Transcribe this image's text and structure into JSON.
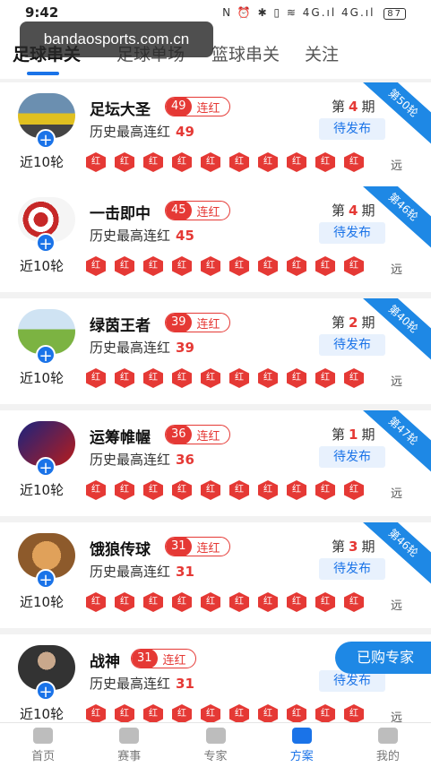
{
  "status": {
    "time": "9:42",
    "icons": "N ⏰ ✱ ▯ ≋ 4G.ıl 4G.ıl",
    "battery": "87"
  },
  "watermark": "bandaosports.com.cn",
  "tabs": [
    "足球串关",
    "足球单场",
    "篮球串关",
    "关注"
  ],
  "labels": {
    "hist": "历史最高连红",
    "streak": "连红",
    "recent": "近10轮",
    "far": "远",
    "round_prefix": "第",
    "round_suffix": "期",
    "pending": "待发布",
    "mark": "红"
  },
  "experts": [
    {
      "name": "足坛大圣",
      "streak": "49",
      "best": "49",
      "round": "4",
      "ribbon": "第50轮",
      "avatar": "yellow-car"
    },
    {
      "name": "一击即中",
      "streak": "45",
      "best": "45",
      "round": "4",
      "ribbon": "第46轮",
      "avatar": "target-dart"
    },
    {
      "name": "绿茵王者",
      "streak": "39",
      "best": "39",
      "round": "2",
      "ribbon": "第40轮",
      "avatar": "green-field"
    },
    {
      "name": "运筹帷幄",
      "streak": "36",
      "best": "36",
      "round": "1",
      "ribbon": "第47轮",
      "avatar": "football-player"
    },
    {
      "name": "饿狼传球",
      "streak": "31",
      "best": "31",
      "round": "3",
      "ribbon": "第46轮",
      "avatar": "cartoon-face"
    },
    {
      "name": "战神",
      "streak": "31",
      "best": "31",
      "round": "",
      "ribbon": "",
      "avatar": "man-portrait"
    }
  ],
  "buy_expert": "已购专家",
  "tabbar": [
    "首页",
    "赛事",
    "专家",
    "方案",
    "我的"
  ],
  "colors": {
    "accent": "#1a73e8",
    "red": "#e53935"
  }
}
